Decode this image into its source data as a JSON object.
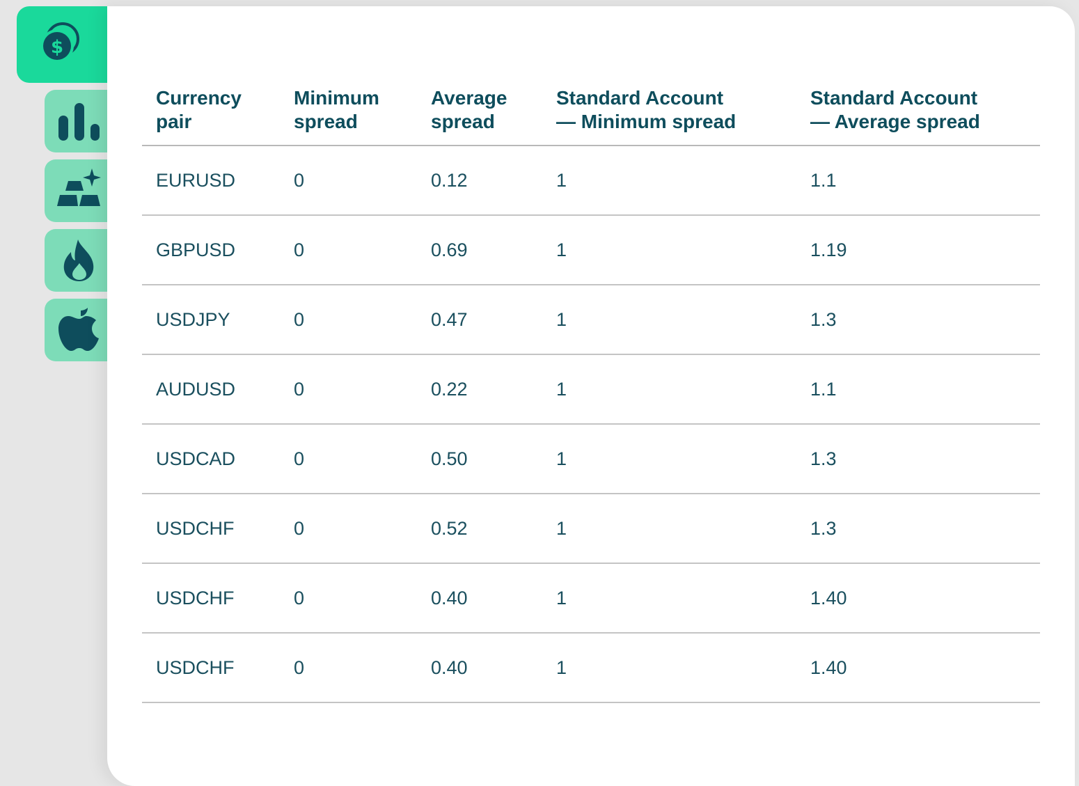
{
  "tabs": [
    {
      "id": "forex",
      "icon": "dollar-coins-icon",
      "active": true
    },
    {
      "id": "indices",
      "icon": "bar-chart-icon",
      "active": false
    },
    {
      "id": "metals",
      "icon": "gold-bars-icon",
      "active": false
    },
    {
      "id": "energy",
      "icon": "flame-icon",
      "active": false
    },
    {
      "id": "stocks",
      "icon": "apple-icon",
      "active": false
    }
  ],
  "colors": {
    "accent_active": "#1ad99b",
    "accent_inactive": "#7ddcb8",
    "icon_dark": "#0e4d5c",
    "text": "#0e4d5c"
  },
  "table": {
    "headers": {
      "pair": "Currency\npair",
      "min_spread": "Minimum\nspread",
      "avg_spread": "Average\nspread",
      "std_min": "Standard Account\n— Minimum spread",
      "std_avg": "Standard Account\n— Average spread"
    },
    "rows": [
      {
        "pair": "EURUSD",
        "min": "0",
        "avg": "0.12",
        "std_min": "1",
        "std_avg": "1.1"
      },
      {
        "pair": "GBPUSD",
        "min": "0",
        "avg": "0.69",
        "std_min": "1",
        "std_avg": "1.19"
      },
      {
        "pair": "USDJPY",
        "min": "0",
        "avg": "0.47",
        "std_min": "1",
        "std_avg": "1.3"
      },
      {
        "pair": "AUDUSD",
        "min": "0",
        "avg": "0.22",
        "std_min": "1",
        "std_avg": "1.1"
      },
      {
        "pair": "USDCAD",
        "min": "0",
        "avg": "0.50",
        "std_min": "1",
        "std_avg": "1.3"
      },
      {
        "pair": "USDCHF",
        "min": "0",
        "avg": "0.52",
        "std_min": "1",
        "std_avg": "1.3"
      },
      {
        "pair": "USDCHF",
        "min": "0",
        "avg": "0.40",
        "std_min": "1",
        "std_avg": "1.40"
      },
      {
        "pair": "USDCHF",
        "min": "0",
        "avg": "0.40",
        "std_min": "1",
        "std_avg": "1.40"
      }
    ]
  }
}
